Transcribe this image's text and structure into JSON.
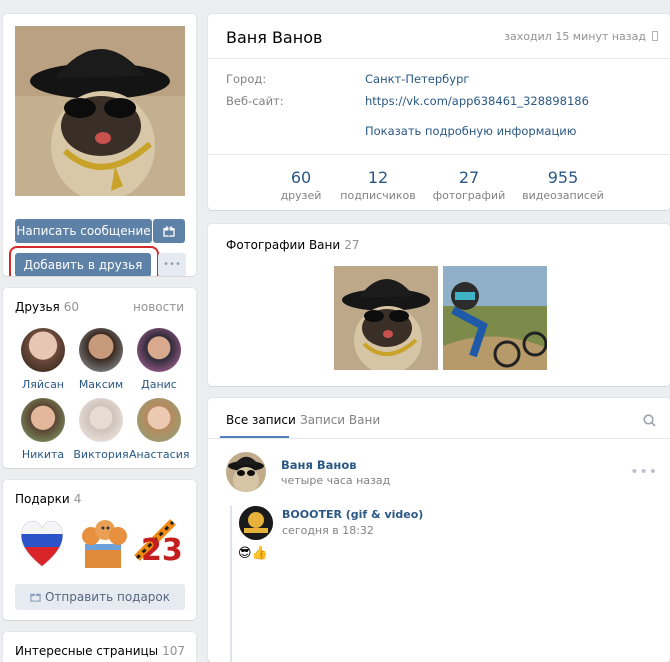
{
  "left": {
    "send_message": "Написать сообщение",
    "add_friend": "Добавить в друзья",
    "more": "•••",
    "friends": {
      "title": "Друзья",
      "count": "60",
      "updates_link": "новости",
      "items": [
        {
          "name": "Ляйсан"
        },
        {
          "name": "Максим"
        },
        {
          "name": "Данис"
        },
        {
          "name": "Никита"
        },
        {
          "name": "Виктория"
        },
        {
          "name": "Анастасия"
        }
      ]
    },
    "gifts": {
      "title": "Подарки",
      "count": "4",
      "send_label": "Отправить подарок"
    },
    "pages": {
      "title": "Интересные страницы",
      "count": "107"
    }
  },
  "profile": {
    "name": "Ваня Ванов",
    "last_seen": "заходил 15 минут назад",
    "city_label": "Город:",
    "city_value": "Санкт-Петербург",
    "site_label": "Веб-сайт:",
    "site_value": "https://vk.com/app638461_328898186",
    "more_info": "Показать подробную информацию",
    "stats": [
      {
        "num": "60",
        "label": "друзей"
      },
      {
        "num": "12",
        "label": "подписчиков"
      },
      {
        "num": "27",
        "label": "фотографий"
      },
      {
        "num": "955",
        "label": "видеозаписей"
      }
    ]
  },
  "photos": {
    "title": "Фотографии Вани",
    "count": "27"
  },
  "wall": {
    "tabs": [
      "Все записи",
      "Записи Вани"
    ],
    "post": {
      "author": "Ваня Ванов",
      "time": "четыре часа назад",
      "repost_author": "BOOOTER (gif & video)",
      "repost_time": "сегодня в 18:32",
      "emoji": "😎👍"
    }
  },
  "colors": {
    "accent": "#5e81a8",
    "link": "#2a5885",
    "highlight_ring": "#d22b2b"
  }
}
